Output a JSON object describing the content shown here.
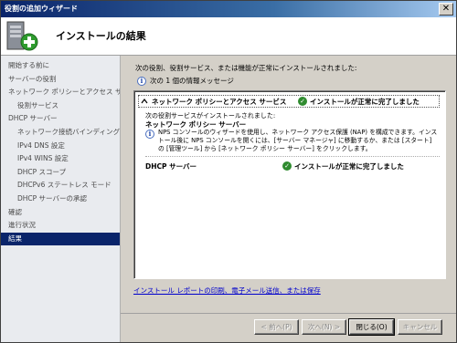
{
  "window": {
    "title": "役割の追加ウィザード",
    "close_glyph": "✕"
  },
  "header": {
    "title": "インストールの結果",
    "icon": "server-add-icon"
  },
  "sidebar": {
    "items": [
      {
        "label": "開始する前に",
        "level": 0
      },
      {
        "label": "サーバーの役割",
        "level": 0
      },
      {
        "label": "ネットワーク ポリシーとアクセス サービ...",
        "level": 0
      },
      {
        "label": "役割サービス",
        "level": 1
      },
      {
        "label": "DHCP サーバー",
        "level": 0
      },
      {
        "label": "ネットワーク接続バインディング",
        "level": 1
      },
      {
        "label": "IPv4 DNS 設定",
        "level": 1
      },
      {
        "label": "IPv4 WINS 設定",
        "level": 1
      },
      {
        "label": "DHCP スコープ",
        "level": 1
      },
      {
        "label": "DHCPv6 ステートレス モード",
        "level": 1
      },
      {
        "label": "DHCP サーバーの承認",
        "level": 1
      },
      {
        "label": "確認",
        "level": 0
      },
      {
        "label": "進行状況",
        "level": 0
      },
      {
        "label": "結果",
        "level": 0,
        "active": true
      }
    ]
  },
  "main": {
    "intro": "次の役割、役割サービス、または機能が正常にインストールされました:",
    "info_count": "次の 1 個の情報メッセージ",
    "results": {
      "role1": {
        "name": "ネットワーク ポリシーとアクセス サービス",
        "status": "インストールが正常に完了しました",
        "installed_line": "次の役割サービスがインストールされました:",
        "service": "ネットワーク ポリシー サーバー",
        "message": "NPS コンソールのウィザードを使用し、ネットワーク アクセス保護 (NAP) を構成できます。インストール後に NPS コンソールを開くには、[サーバー マネージャ] に移動するか、または [スタート] の [管理ツール] から [ネットワーク ポリシー サーバー] をクリックします。"
      },
      "role2": {
        "name": "DHCP サーバー",
        "status": "インストールが正常に完了しました"
      }
    },
    "link": "インストール レポートの印刷、電子メール送信、または保存"
  },
  "footer": {
    "back": "< 前へ(P)",
    "next": "次へ(N) >",
    "close": "閉じる(O)",
    "cancel": "キャンセル"
  }
}
